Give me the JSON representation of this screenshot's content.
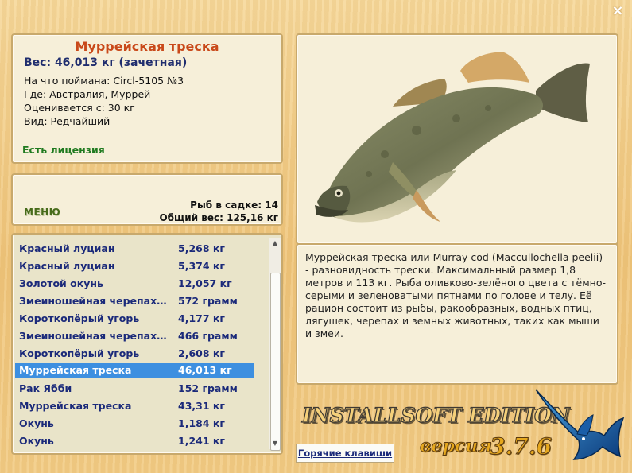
{
  "window": {
    "close_label": "×"
  },
  "fish": {
    "name": "Муррейская треска",
    "weight_line": "Вес: 46,013 кг (зачетная)",
    "details": [
      "На что поймана: Circl-5105 №3",
      "Где: Австралия, Муррей",
      "Оценивается с: 30 кг",
      "Вид: Редчайший"
    ],
    "license": "Есть лицензия",
    "description": "Муррейская треска или Murray cod (Maccullochella peelii) - разновидность трески. Максимальный размер 1,8 метров и 113 кг. Рыба оливково-зелёного цвета с тёмно-серыми и зеленоватыми пятнами по голове и телу. Её рацион состоит из рыбы, ракообразных, водных птиц, лягушек, черепах и земных животных, таких как мыши и змеи."
  },
  "menu": {
    "button_label": "МЕНЮ",
    "stats": [
      "Рыб в садке: 14",
      "Общий вес: 125,16 кг"
    ]
  },
  "catch_list": [
    {
      "name": "Красный луциан",
      "weight": "5,268 кг"
    },
    {
      "name": "Красный луциан",
      "weight": "5,374 кг"
    },
    {
      "name": "Золотой окунь",
      "weight": "12,057 кг"
    },
    {
      "name": "Змеиношейная черепах…",
      "weight": "572 грамм"
    },
    {
      "name": "Короткопёрый угорь",
      "weight": "4,177 кг"
    },
    {
      "name": "Змеиношейная черепах…",
      "weight": "466 грамм"
    },
    {
      "name": "Короткопёрый угорь",
      "weight": "2,608 кг"
    },
    {
      "name": "Муррейская треска",
      "weight": "46,013 кг",
      "selected": true
    },
    {
      "name": "Рак Ябби",
      "weight": "152 грамм"
    },
    {
      "name": "Муррейская треска",
      "weight": "43,31 кг"
    },
    {
      "name": "Окунь",
      "weight": "1,184 кг"
    },
    {
      "name": "Окунь",
      "weight": "1,241 кг"
    }
  ],
  "footer": {
    "hotkeys_label": "Горячие клавиши",
    "brand": "INSTALLSOFT EDITION",
    "version_label": "версия",
    "version": "3.7.6"
  },
  "colors": {
    "accent_title": "#c9491a",
    "list_text": "#1b2a7a",
    "selection": "#3d8fe0",
    "license": "#1f7a1f"
  },
  "icons": {
    "close": "close-icon",
    "fish": "murray-cod-image",
    "marlin": "marlin-logo"
  }
}
